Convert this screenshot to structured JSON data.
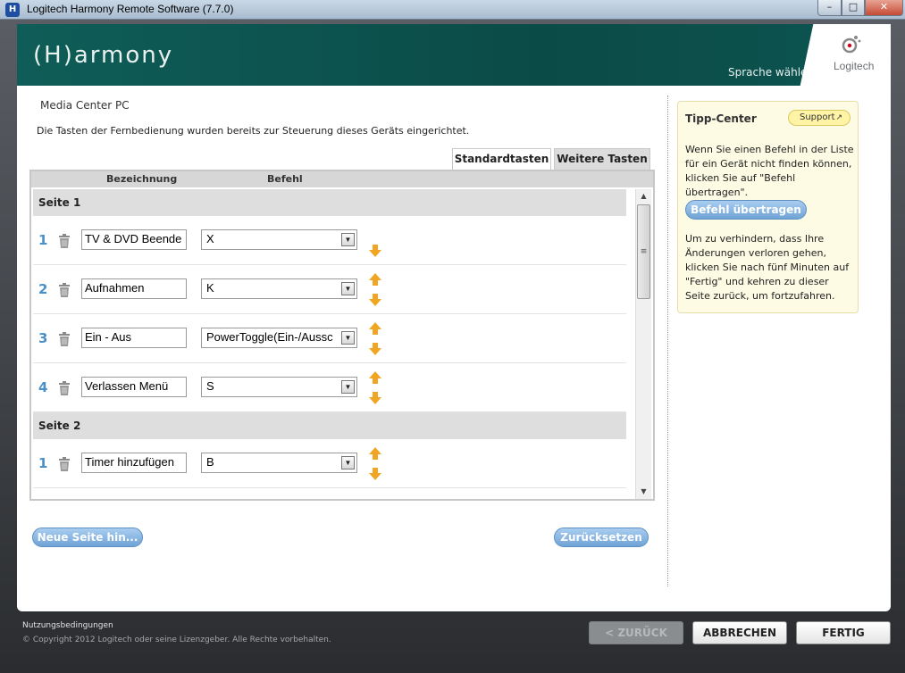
{
  "window": {
    "title": "Logitech Harmony Remote Software (7.7.0)",
    "min": "–",
    "max": "□",
    "close": "✕"
  },
  "header": {
    "brand": "(H)armony",
    "language_link": "Sprache wählen",
    "logo_text": "Logitech"
  },
  "page": {
    "device": "Media Center PC",
    "intro": "Die Tasten der Fernbedienung wurden bereits zur Steuerung dieses Geräts eingerichtet.",
    "tabs": {
      "standard": "Standardtasten",
      "more": "Weitere Tasten"
    },
    "columns": {
      "name": "Bezeichnung",
      "command": "Befehl"
    },
    "sections": [
      {
        "label": "Seite 1",
        "rows": [
          {
            "num": "1",
            "name": "TV & DVD Beende",
            "command": "X"
          },
          {
            "num": "2",
            "name": "Aufnahmen",
            "command": "K"
          },
          {
            "num": "3",
            "name": "Ein - Aus",
            "command": "PowerToggle(Ein-/Aussc"
          },
          {
            "num": "4",
            "name": "Verlassen Menü",
            "command": "S"
          }
        ]
      },
      {
        "label": "Seite 2",
        "rows": [
          {
            "num": "1",
            "name": "Timer hinzufügen",
            "command": "B"
          }
        ]
      }
    ],
    "add_page_button": "Neue Seite hin...",
    "reset_button": "Zurücksetzen"
  },
  "tipp": {
    "title": "Tipp-Center",
    "support": "Support",
    "text1": "Wenn Sie einen Befehl in der Liste für ein Gerät nicht finden können, klicken Sie auf \"Befehl übertragen\".",
    "transfer_button": "Befehl übertragen",
    "text2": "Um zu verhindern, dass Ihre Änderungen verloren gehen, klicken Sie nach fünf Minuten auf \"Fertig\" und kehren zu dieser Seite zurück, um fortzufahren."
  },
  "footer": {
    "terms": "Nutzungsbedingungen",
    "copyright": "© Copyright 2012 Logitech oder seine Lizenzgeber. Alle Rechte vorbehalten.",
    "back": "< ZURÜCK",
    "cancel": "ABBRECHEN",
    "done": "FERTIG"
  },
  "colors": {
    "header": "#0d5450",
    "accent": "#4a90c8",
    "pill": "#6fa3d6",
    "arrow": "#f0a623"
  }
}
